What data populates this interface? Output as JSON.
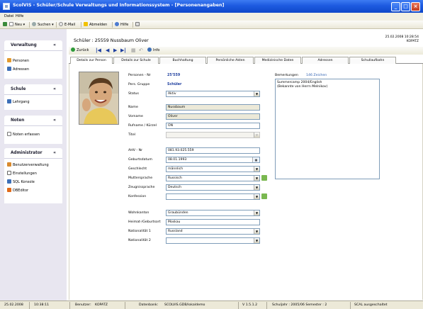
{
  "window": {
    "title": "ScolVIS - Schüler/Schule Verwaltungs und Informationssystem - [Personenangaben]",
    "controls": {
      "minimize": "_",
      "maximize": "□",
      "close": "×"
    }
  },
  "menu": [
    "Datei",
    "Hilfe"
  ],
  "toolbar": {
    "new": "Neu ▾",
    "search": "Suchen ▾",
    "email": "E-Mail",
    "logout": "Abmelden",
    "help": "Hilfe"
  },
  "sidebar": {
    "groups": [
      {
        "title": "Verwaltung",
        "items": [
          "Personen",
          "Adressen"
        ]
      },
      {
        "title": "Schule",
        "items": [
          "Lehrgang"
        ]
      },
      {
        "title": "Noten",
        "items": [
          "Noten erfassen"
        ]
      },
      {
        "title": "Administrator",
        "items": [
          "Benutzerverwaltung",
          "Einstellungen",
          "SQL Konsole",
          "DBEditor"
        ]
      }
    ]
  },
  "header": {
    "title": "Schüler : 25559  Nussbaum Oliver",
    "datetime": "25.02.2008 10:28:54",
    "user": "KOPATZ"
  },
  "subtoolbar": {
    "back": "Zurück",
    "info": "Info"
  },
  "tabs": [
    "Details zur Person",
    "Details zur Schule",
    "Buchhaltung",
    "Persönliche Akten",
    "Medizinische Daten",
    "Adressen",
    "Schullaufbahn"
  ],
  "form": {
    "personen_nr_label": "Personen - Nr",
    "personen_nr_value": "25'559",
    "gruppe_label": "Pers. Gruppe",
    "gruppe_value": "Schüler",
    "status_label": "Status",
    "status_value": "Aktiv",
    "name_label": "Name",
    "name_value": "Nussbaum",
    "vorname_label": "Vorname",
    "vorname_value": "Oliver",
    "rufname_label": "Rufname / Kürzel",
    "rufname_value": "ON",
    "titel_label": "Titel",
    "titel_value": "",
    "ahv_label": "AHV - Nr",
    "ahv_value": "081.93.025.559",
    "geburt_label": "Geburtsdatum",
    "geburt_value": "08.01.1993",
    "geschlecht_label": "Geschlecht",
    "geschlecht_value": "männlich",
    "mutter_label": "Muttersprache",
    "mutter_value": "Russisch",
    "zeugnis_label": "Zeugnissprache",
    "zeugnis_value": "Deutsch",
    "konfession_label": "Konfession",
    "konfession_value": "",
    "wohnkanton_label": "Wohnkanton",
    "wohnkanton_value": "Graubünden",
    "heimat_label": "Heimat-/Geburtsort",
    "heimat_value": "Moskau",
    "nat1_label": "Nationalität 1",
    "nat1_value": "Russland",
    "nat2_label": "Nationalität 2",
    "nat2_value": ""
  },
  "remarks": {
    "label": "Bemerkungen",
    "count": "146 Zeichen",
    "line1": "Summercamp 2004/English",
    "line2": "(Bekannte von Herrn Melnikov)"
  },
  "status": {
    "date": "25.02.2008",
    "time": "10:38:11",
    "user_label": "Benutzer:",
    "user": "KOPATZ",
    "db_label": "Datenbank:",
    "db": "SCOLVIS.GDB/lokaldemo",
    "version": "V 1.5.1.2",
    "schuljahr": "Schuljahr : 2005/06  Semester : 2",
    "scal": "SCAL ausgeschaltet"
  },
  "colors": {
    "title_bar": "#1d5ae0",
    "accent_blue": "#1f3f9f",
    "remarks_count": "#2a5db0"
  }
}
